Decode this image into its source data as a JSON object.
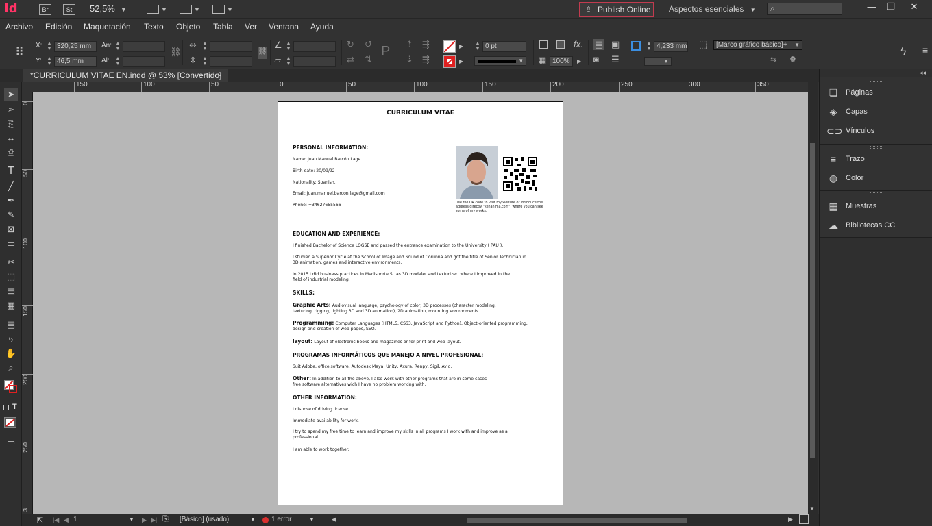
{
  "app": {
    "logo": "Id",
    "bridge_badge": "Br",
    "stock_badge": "St",
    "zoom": "52,5%",
    "publish": "Publish Online",
    "workspace": "Aspectos esenciales"
  },
  "menu": [
    "Archivo",
    "Edición",
    "Maquetación",
    "Texto",
    "Objeto",
    "Tabla",
    "Ver",
    "Ventana",
    "Ayuda"
  ],
  "control": {
    "x_label": "X:",
    "x_value": "320,25 mm",
    "y_label": "Y:",
    "y_value": "46,5 mm",
    "w_label": "An:",
    "h_label": "Al:",
    "stroke_weight": "0 pt",
    "opacity": "100%",
    "offset": "4,233 mm",
    "object_style": "[Marco gráfico básico]+"
  },
  "tab": {
    "title": "*CURRICULUM VITAE EN.indd @ 53% [Convertido]",
    "close": "×"
  },
  "ruler_h": [
    "150",
    "100",
    "50",
    "0",
    "50",
    "100",
    "150",
    "200",
    "250",
    "300",
    "350"
  ],
  "ruler_v": [
    "0",
    "50",
    "100",
    "150",
    "200",
    "250",
    "3"
  ],
  "cv": {
    "title": "CURRICULUM VITAE",
    "personal_heading": "PERSONAL INFORMATION:",
    "name": "Name: Juan Manuel Barcón Lage",
    "birth": "Birth date: 20/09/92",
    "nationality": "Nationality: Spanish.",
    "email": "Email: juan.manuel.barcon.lage@gmail.com",
    "phone": "Phone: +34627655566",
    "qr_note": "Use the QR code to visit my website or introduce the address directly \"kenanima.com\", where you can see some of my works.",
    "education_heading": "EDUCATION AND EXPERIENCE:",
    "edu1": "I finished Bachelor of Science LOGSE and passed the entrance examination to the University ( PAU ).",
    "edu2": "I studied a Superior Cycle at the School of Image and Sound of Corunna and got the title of Senior Technician in\n3D animation, games and interactive environments.",
    "edu3": "In 2015 I did business practices in Medisnorte SL as 3D modeler and texturizer, where I improved in the\nfield of industrial modeling.",
    "skills_heading": "SKILLS:",
    "graphic_label": "Graphic Arts:",
    "graphic_text": " Audiovisual language, psychology of color, 3D processes (character modeling,\ntexturing, rigging, lighting 3D and 3D animation), 2D animation, mounting environments.",
    "programming_label": "Programming:",
    "programming_text": " Computer Languages (HTML5, CSS3, JavaScript and Python), Object-oriented programming,\ndesign and creation of web pages, SEO.",
    "layout_label": "layout:",
    "layout_text": " Layout of electronic books and magazines or for print and web layout.",
    "programs_heading": "PROGRAMAS INFORMÁTICOS QUE MANEJO A NIVEL PROFESIONAL:",
    "programs_text": "Suit Adobe, office software, Autodesk Maya, Unity, Axura, Renpy, Sigil, Avid.",
    "other_label": "Other:",
    "other_text": " In addition to all the above, I also work with other programs that are in some cases\nfree software alternatives wich I have no problem working with.",
    "other_info_heading": "OTHER INFORMATION:",
    "info1": "I dispose of driving license.",
    "info2": "Immediate availability for work.",
    "info3": "I try to spend my free time to learn and improve my skills in all programs I work with and improve as a\nprofessional",
    "info4": "I am able to work together."
  },
  "status": {
    "page": "1",
    "master": "[Básico] (usado)",
    "errors": "1 error"
  },
  "panels": {
    "pages": "Páginas",
    "layers": "Capas",
    "links": "Vínculos",
    "stroke": "Trazo",
    "color": "Color",
    "swatches": "Muestras",
    "libraries": "Bibliotecas CC"
  },
  "colors": {
    "accent": "#ff3366",
    "publish_border": "#c23b4f",
    "pasteboard": "#b7b7b7",
    "error_dot": "#d9302f"
  }
}
